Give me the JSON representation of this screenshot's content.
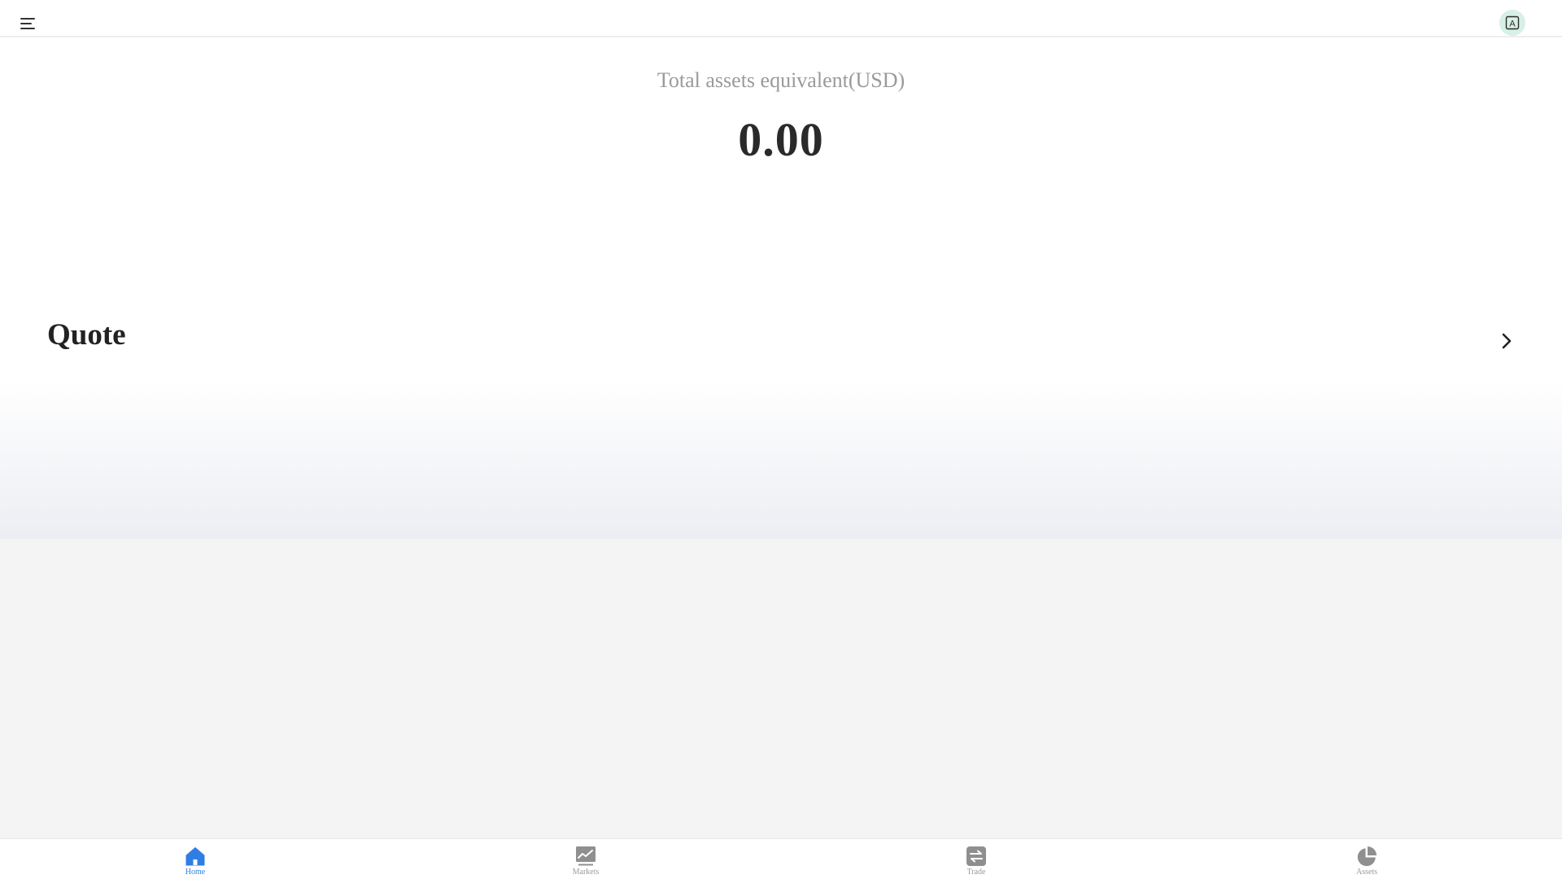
{
  "header": {
    "menu_icon": "hamburger-menu-icon",
    "avatar_icon": "translate-icon",
    "avatar_letter": "A"
  },
  "summary": {
    "label": "Total assets equivalent(USD)",
    "value": "0.00"
  },
  "quote": {
    "title": "Quote",
    "arrow_icon": "chevron-right-icon"
  },
  "tabbar": {
    "active_color": "#2f7ee3",
    "inactive_color": "#9a9a9a",
    "tabs": [
      {
        "label": "Home",
        "icon": "home-icon",
        "active": true
      },
      {
        "label": "Markets",
        "icon": "chart-icon",
        "active": false
      },
      {
        "label": "Trade",
        "icon": "exchange-icon",
        "active": false
      },
      {
        "label": "Assets",
        "icon": "pie-chart-icon",
        "active": false
      }
    ]
  }
}
